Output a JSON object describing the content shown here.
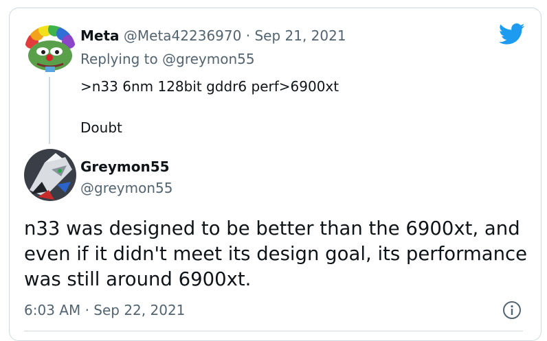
{
  "reply_tweet": {
    "name": "Meta",
    "handle": "@Meta42236970",
    "separator": "·",
    "date": "Sep 21, 2021",
    "replying_to_label": "Replying to",
    "replying_to_handle": "@greymon55",
    "text_line1": ">n33 6nm 128bit gddr6 perf>6900xt",
    "text_line2": "Doubt"
  },
  "main_tweet": {
    "name": "Greymon55",
    "handle": "@greymon55",
    "text": "n33 was designed to be better than the 6900xt, and even if it didn't meet its design goal, its performance was still around 6900xt.",
    "timestamp": "6:03 AM · Sep 22, 2021"
  },
  "icons": {
    "brand": "twitter-bird-icon",
    "info": "info-icon",
    "brand_color": "#1d9bf0"
  }
}
